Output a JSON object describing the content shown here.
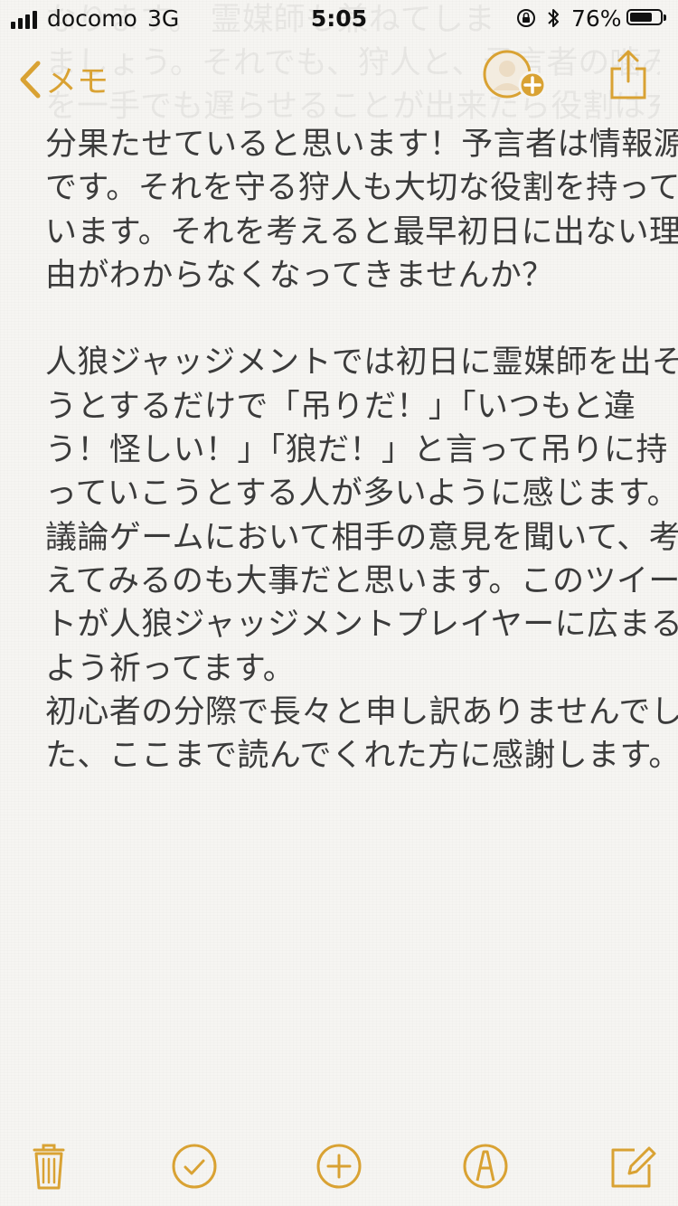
{
  "status_bar": {
    "carrier": "docomo",
    "network": "3G",
    "time": "5:05",
    "battery": "76%",
    "battery_level": 0.76,
    "signal_bars": 4,
    "icons": [
      "signal-icon",
      "orientation-lock-icon",
      "bluetooth-icon",
      "battery-icon"
    ]
  },
  "ghost_text": [
    "なります。 霊媒師も兼ねてしま",
    "ましょう。それでも、狩人と、予言者の噛み",
    "を一手でも遅らせることが出来たら役割は充"
  ],
  "nav": {
    "back_label": "メモ",
    "icons": [
      "chevron-left-icon",
      "add-person-icon",
      "share-icon"
    ]
  },
  "note": {
    "paragraphs": [
      [
        "分果たせていると思います！予言者は情報源",
        "です。それを守る狩人も大切な役割を持って",
        "います。それを考えると最早初日に出ない理",
        "由がわからなくなってきませんか？"
      ],
      [
        "人狼ジャッジメントでは初日に霊媒師を出そ",
        "うとするだけで「吊りだ！」「いつもと違",
        "う！怪しい！」「狼だ！」と言って吊りに持",
        "っていこうとする人が多いように感じます。",
        "議論ゲームにおいて相手の意見を聞いて、考",
        "えてみるのも大事だと思います。このツイー",
        "トが人狼ジャッジメントプレイヤーに広まる",
        "よう祈ってます。",
        "初心者の分際で長々と申し訳ありませんでし",
        "た、ここまで読んでくれた方に感謝します。"
      ]
    ]
  },
  "toolbar": {
    "icons": [
      "trash-icon",
      "checklist-icon",
      "add-icon",
      "sketch-icon",
      "compose-icon"
    ]
  },
  "colors": {
    "accent": "#d9a233",
    "background": "#f6f5f2",
    "text": "#3b3b3b"
  }
}
